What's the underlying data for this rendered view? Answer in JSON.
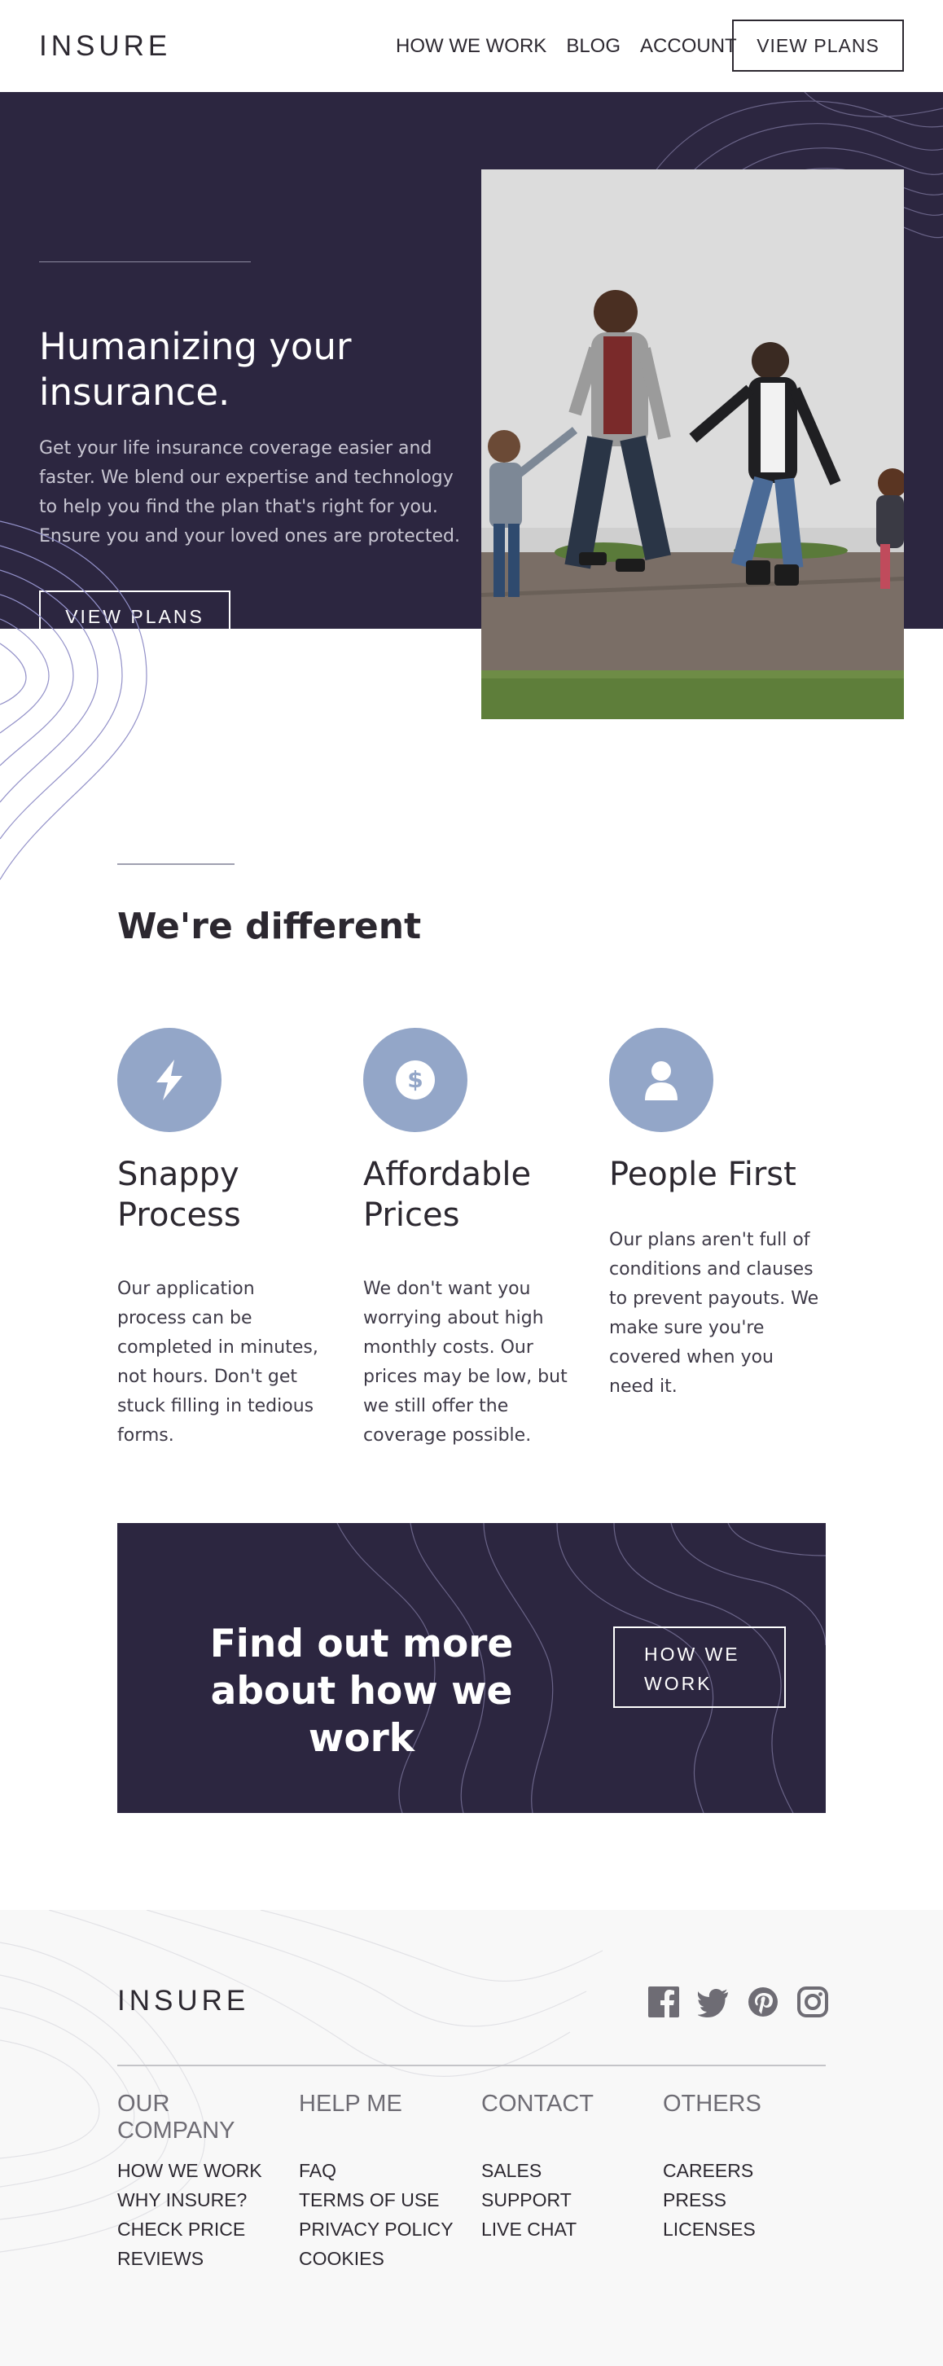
{
  "header": {
    "logo": "INSURE",
    "nav": [
      "HOW WE WORK",
      "BLOG",
      "ACCOUNT"
    ],
    "cta_label": "VIEW PLANS"
  },
  "hero": {
    "title": "Humanizing your insurance.",
    "text": "Get your life insurance coverage easier and faster. We blend our expertise and technology to help you find the plan that's right for you. Ensure you and your loved ones are protected.",
    "button_label": "VIEW PLANS"
  },
  "different": {
    "title": "We're different",
    "features": [
      {
        "icon": "lightning-icon",
        "title": "Snappy Process",
        "text": "Our application process can be completed in minutes, not hours. Don't get stuck filling in tedious forms."
      },
      {
        "icon": "dollar-icon",
        "title": "Affordable Prices",
        "text": "We don't want you worrying about high monthly costs. Our prices may be low, but we still offer the coverage possible."
      },
      {
        "icon": "person-icon",
        "title": "People First",
        "text": "Our plans aren't full of conditions and clauses to prevent payouts. We make sure you're covered when you need it."
      }
    ]
  },
  "cta": {
    "title": "Find out more about how we work",
    "button_label": "HOW WE WORK"
  },
  "footer": {
    "logo": "INSURE",
    "socials": [
      "facebook-icon",
      "twitter-icon",
      "pinterest-icon",
      "instagram-icon"
    ],
    "columns": [
      {
        "title": "OUR COMPANY",
        "links": [
          "HOW WE WORK",
          "WHY INSURE?",
          "CHECK PRICE",
          "REVIEWS"
        ]
      },
      {
        "title": "HELP ME",
        "links": [
          "FAQ",
          "TERMS OF USE",
          "PRIVACY POLICY",
          "COOKIES"
        ]
      },
      {
        "title": "CONTACT",
        "links": [
          "SALES",
          "SUPPORT",
          "LIVE CHAT"
        ]
      },
      {
        "title": "OTHERS",
        "links": [
          "CAREERS",
          "PRESS",
          "LICENSES"
        ]
      }
    ]
  },
  "colors": {
    "dark_violet": "#2c2640",
    "icon_blue": "#93a6c8",
    "footer_bg": "#f8f8f8"
  }
}
